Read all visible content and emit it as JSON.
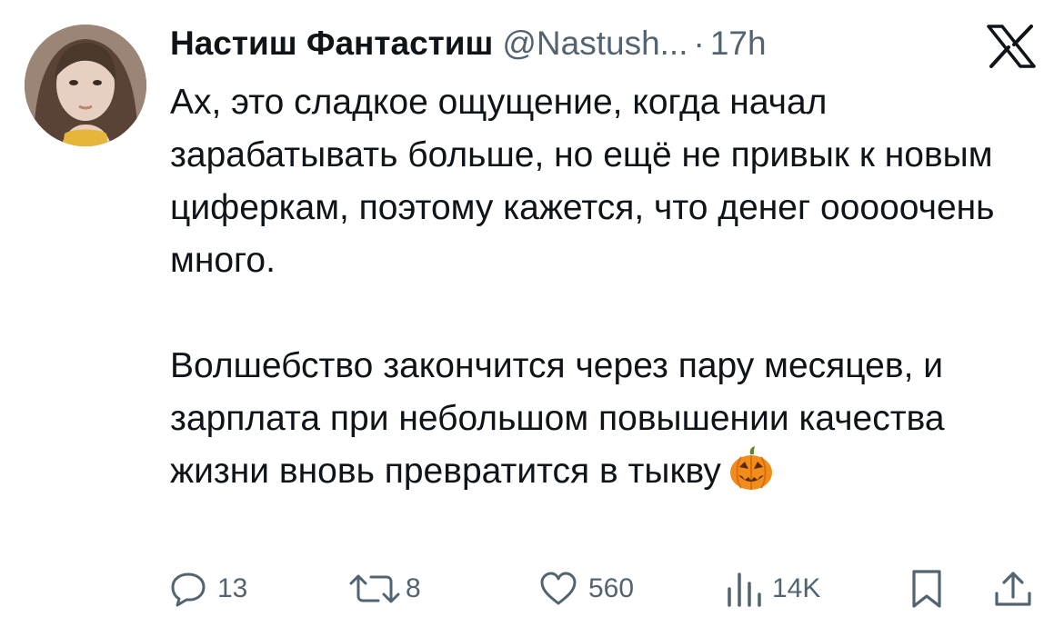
{
  "tweet": {
    "author_name": "Настиш Фантастиш",
    "handle": "@Nastush...",
    "separator": "·",
    "time": "17h",
    "paragraph1": "Ах, это сладкое ощущение, когда начал зарабатывать больше, но ещё не привык к новым циферкам, поэтому кажется, что денег ооооочень много.",
    "paragraph2": "Волшебство закончится через пару месяцев, и зарплата при небольшом повышении качества жизни вновь превратится в тыкву",
    "emoji": "jack-o-lantern"
  },
  "actions": {
    "replies": "13",
    "retweets": "8",
    "likes": "560",
    "views": "14K"
  },
  "icons": [
    "avatar-photo",
    "x-logo-icon",
    "reply-icon",
    "retweet-icon",
    "like-icon",
    "views-icon",
    "bookmark-icon",
    "share-icon",
    "jack-o-lantern-emoji"
  ],
  "colors": {
    "text": "#0f1419",
    "secondary": "#536471",
    "background": "#ffffff",
    "pumpkin": "#f28c1a"
  }
}
